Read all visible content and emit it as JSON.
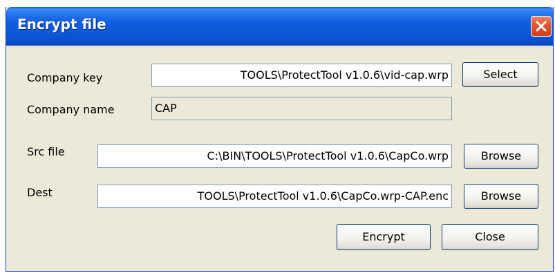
{
  "window": {
    "title": "Encrypt file"
  },
  "company_key": {
    "label": "Company key",
    "value": "TOOLS\\ProtectTool v1.0.6\\vid-cap.wrp",
    "button": "Select"
  },
  "company_name": {
    "label": "Company name",
    "value": "CAP"
  },
  "src_file": {
    "label": "Src file",
    "value": "C:\\BIN\\TOOLS\\ProtectTool v1.0.6\\CapCo.wrp",
    "button": "Browse"
  },
  "dest": {
    "label": "Dest",
    "value": "TOOLS\\ProtectTool v1.0.6\\CapCo.wrp-CAP.enc",
    "button": "Browse"
  },
  "actions": {
    "encrypt": "Encrypt",
    "close": "Close"
  }
}
